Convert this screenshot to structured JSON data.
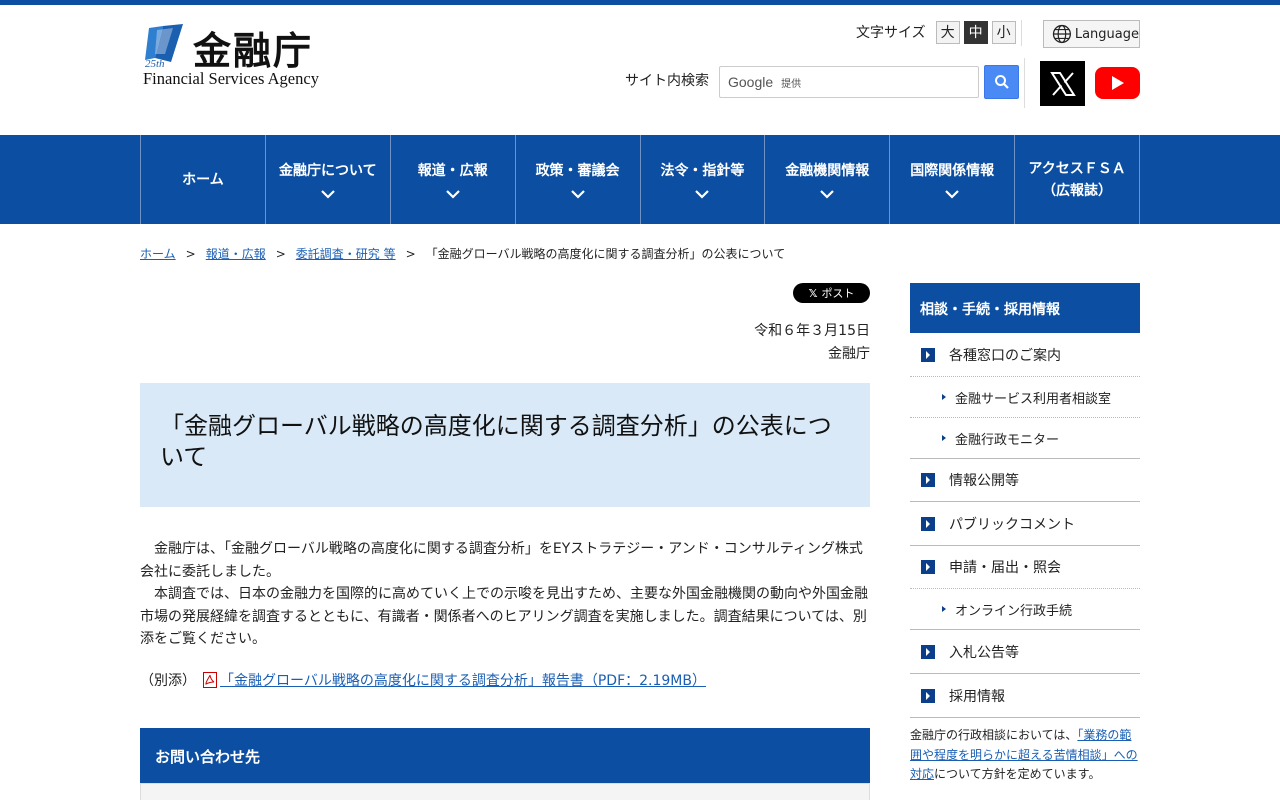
{
  "header": {
    "logo_jp": "金融庁",
    "logo_en": "Financial Services Agency",
    "logo_badge": "25th",
    "fontsize_label": "文字サイズ",
    "fontsize_options": [
      "大",
      "中",
      "小"
    ],
    "fontsize_selected": "中",
    "language_label": "Language",
    "search_label": "サイト内検索",
    "search_google": "Google",
    "search_provided": "提供"
  },
  "nav": {
    "items": [
      {
        "label": "ホーム"
      },
      {
        "label": "金融庁について"
      },
      {
        "label": "報道・広報"
      },
      {
        "label": "政策・審議会"
      },
      {
        "label": "法令・指針等"
      },
      {
        "label": "金融機関情報"
      },
      {
        "label": "国際関係情報"
      },
      {
        "label_line1": "アクセスＦＳＡ",
        "label_line2": "（広報誌）"
      }
    ]
  },
  "breadcrumb": {
    "items": [
      "ホーム",
      "報道・広報",
      "委託調査・研究 等"
    ],
    "current": "「金融グローバル戦略の高度化に関する調査分析」の公表について",
    "separator": ">"
  },
  "article": {
    "post_label": "ポスト",
    "date": "令和６年３月15日",
    "org": "金融庁",
    "title": "「金融グローバル戦略の高度化に関する調査分析」の公表について",
    "para1": "金融庁は、「金融グローバル戦略の高度化に関する調査分析」をEYストラテジー・アンド・コンサルティング株式会社に委託しました。",
    "para2": "本調査では、日本の金融力を国際的に高めていく上での示唆を見出すため、主要な外国金融機関の動向や外国金融市場の発展経緯を調査するとともに、有識者・関係者へのヒアリング調査を実施しました。調査結果については、別添をご覧ください。",
    "attach_prefix": "（別添）",
    "attach_link": "「金融グローバル戦略の高度化に関する調査分析」報告書（PDF：2.19MB）",
    "contact_title": "お問い合わせ先"
  },
  "sidebar": {
    "title": "相談・手続・採用情報",
    "items": [
      {
        "label": "各種窓口のご案内",
        "level": 1
      },
      {
        "label": "金融サービス利用者相談室",
        "level": 2
      },
      {
        "label": "金融行政モニター",
        "level": 2
      },
      {
        "label": "情報公開等",
        "level": 1
      },
      {
        "label": "パブリックコメント",
        "level": 1
      },
      {
        "label": "申請・届出・照会",
        "level": 1
      },
      {
        "label": "オンライン行政手続",
        "level": 2
      },
      {
        "label": "入札公告等",
        "level": 1
      },
      {
        "label": "採用情報",
        "level": 1
      }
    ],
    "note_prefix": "金融庁の行政相談においては、",
    "note_link": "「業務の範囲や程度を明らかに超える苦情相談」への対応",
    "note_suffix": "について方針を定めています。"
  },
  "colors": {
    "brand_blue": "#0b4ea2",
    "title_bg": "#d9e9f7",
    "link": "#1a5fb4"
  }
}
